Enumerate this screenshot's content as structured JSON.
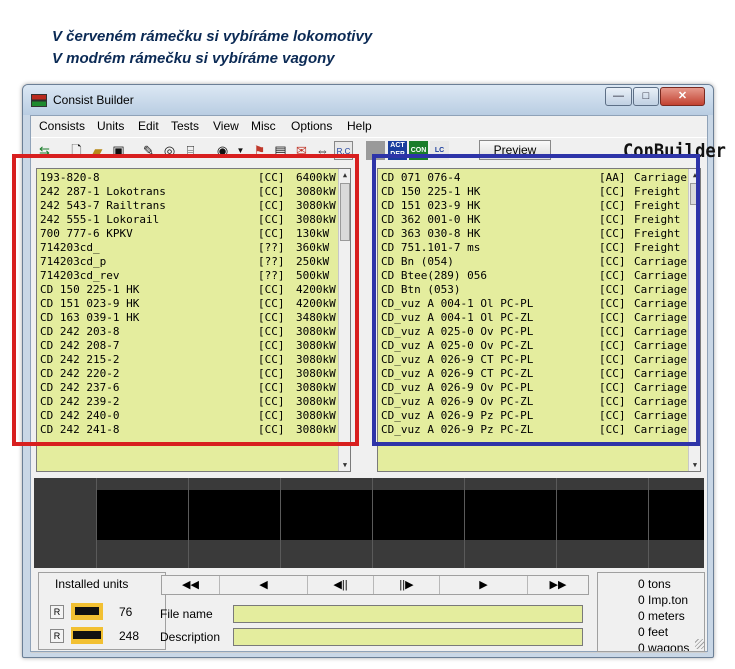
{
  "captions": [
    "V červeném rámečku si vybíráme lokomotivy",
    "V modrém rámečku si vybíráme vagony"
  ],
  "window": {
    "title": "Consist Builder",
    "controls": {
      "minimize": "—",
      "maximize": "□",
      "close": "✕"
    }
  },
  "menu": [
    "Consists",
    "Units",
    "Edit",
    "Tests",
    "View",
    "Misc",
    "Options",
    "Help"
  ],
  "toolbar": {
    "preview_label": "Preview",
    "brand": "ConBuilder",
    "icons": [
      "train-icon",
      "new-file-icon",
      "open-folder-icon",
      "save-icon",
      "tools-icon",
      "wheel-icon",
      "coupler-icon",
      "eye-icon",
      "dropdown-arrow-icon",
      "tag-icon",
      "clipboard-icon",
      "envelope-icon",
      "swap-arrows-icon",
      "rc-icon",
      "gray-square-icon",
      "act-dep-icon",
      "con-icon",
      "lc-icon"
    ],
    "act_dep_label": "ACT DEP",
    "con_label": "CON",
    "lc_label": "LC",
    "rc_label": "R.C"
  },
  "locomotives": [
    {
      "name": "193-820-8",
      "flag": "[CC]",
      "power": "6400kW"
    },
    {
      "name": "242 287-1 Lokotrans",
      "flag": "[CC]",
      "power": "3080kW"
    },
    {
      "name": "242 543-7 Railtrans",
      "flag": "[CC]",
      "power": "3080kW"
    },
    {
      "name": "242 555-1 Lokorail",
      "flag": "[CC]",
      "power": "3080kW"
    },
    {
      "name": "700 777-6 KPKV",
      "flag": "[CC]",
      "power": "130kW"
    },
    {
      "name": "714203cd_",
      "flag": "[??]",
      "power": "360kW"
    },
    {
      "name": "714203cd_p",
      "flag": "[??]",
      "power": "250kW"
    },
    {
      "name": "714203cd_rev",
      "flag": "[??]",
      "power": "500kW"
    },
    {
      "name": "CD 150 225-1 HK",
      "flag": "[CC]",
      "power": "4200kW"
    },
    {
      "name": "CD 151 023-9 HK",
      "flag": "[CC]",
      "power": "4200kW"
    },
    {
      "name": "CD 163 039-1 HK",
      "flag": "[CC]",
      "power": "3480kW"
    },
    {
      "name": "CD 242 203-8",
      "flag": "[CC]",
      "power": "3080kW"
    },
    {
      "name": "CD 242 208-7",
      "flag": "[CC]",
      "power": "3080kW"
    },
    {
      "name": "CD 242 215-2",
      "flag": "[CC]",
      "power": "3080kW"
    },
    {
      "name": "CD 242 220-2",
      "flag": "[CC]",
      "power": "3080kW"
    },
    {
      "name": "CD 242 237-6",
      "flag": "[CC]",
      "power": "3080kW"
    },
    {
      "name": "CD 242 239-2",
      "flag": "[CC]",
      "power": "3080kW"
    },
    {
      "name": "CD 242 240-0",
      "flag": "[CC]",
      "power": "3080kW"
    },
    {
      "name": "CD 242 241-8",
      "flag": "[CC]",
      "power": "3080kW"
    }
  ],
  "wagons": [
    {
      "name": "CD 071 076-4",
      "flag": "[AA]",
      "type": "Carriage"
    },
    {
      "name": "CD 150 225-1 HK",
      "flag": "[CC]",
      "type": "Freight"
    },
    {
      "name": "CD 151 023-9 HK",
      "flag": "[CC]",
      "type": "Freight"
    },
    {
      "name": "CD 362 001-0 HK",
      "flag": "[CC]",
      "type": "Freight"
    },
    {
      "name": "CD 363 030-8 HK",
      "flag": "[CC]",
      "type": "Freight"
    },
    {
      "name": "CD 751.101-7 ms",
      "flag": "[CC]",
      "type": "Freight"
    },
    {
      "name": "CD Bn (054)",
      "flag": "[CC]",
      "type": "Carriage"
    },
    {
      "name": "CD Btee(289) 056",
      "flag": "[CC]",
      "type": "Carriage"
    },
    {
      "name": "CD Btn (053)",
      "flag": "[CC]",
      "type": "Carriage"
    },
    {
      "name": "CD_vuz A 004-1 Ol PC-PL",
      "flag": "[CC]",
      "type": "Carriage"
    },
    {
      "name": "CD_vuz A 004-1 Ol PC-ZL",
      "flag": "[CC]",
      "type": "Carriage"
    },
    {
      "name": "CD_vuz A 025-0 Ov PC-PL",
      "flag": "[CC]",
      "type": "Carriage"
    },
    {
      "name": "CD_vuz A 025-0 Ov PC-ZL",
      "flag": "[CC]",
      "type": "Carriage"
    },
    {
      "name": "CD_vuz A 026-9 CT PC-PL",
      "flag": "[CC]",
      "type": "Carriage"
    },
    {
      "name": "CD_vuz A 026-9 CT PC-ZL",
      "flag": "[CC]",
      "type": "Carriage"
    },
    {
      "name": "CD_vuz A 026-9 Ov PC-PL",
      "flag": "[CC]",
      "type": "Carriage"
    },
    {
      "name": "CD_vuz A 026-9 Ov PC-ZL",
      "flag": "[CC]",
      "type": "Carriage"
    },
    {
      "name": "CD_vuz A 026-9 Pz PC-PL",
      "flag": "[CC]",
      "type": "Carriage"
    },
    {
      "name": "CD_vuz A 026-9 Pz PC-ZL",
      "flag": "[CC]",
      "type": "Carriage"
    }
  ],
  "installed": {
    "title": "Installed units",
    "r_label": "R",
    "engines": "76",
    "wagons": "248"
  },
  "nav": [
    "◀◀",
    "◀",
    "◀||",
    "||▶",
    "▶",
    "▶▶"
  ],
  "fields": {
    "file_name_label": "File name",
    "file_name_value": "",
    "description_label": "Description",
    "description_value": ""
  },
  "stats": [
    {
      "value": "0",
      "unit": "tons"
    },
    {
      "value": "0",
      "unit": "Imp.ton"
    },
    {
      "value": "0",
      "unit": "meters"
    },
    {
      "value": "0",
      "unit": "feet"
    },
    {
      "value": "0",
      "unit": "wagons"
    }
  ],
  "colors": {
    "list_bg": "#e4ed9e",
    "red_frame": "#d81f1f",
    "blue_frame": "#2e34a8",
    "caption": "#0b2a55"
  }
}
